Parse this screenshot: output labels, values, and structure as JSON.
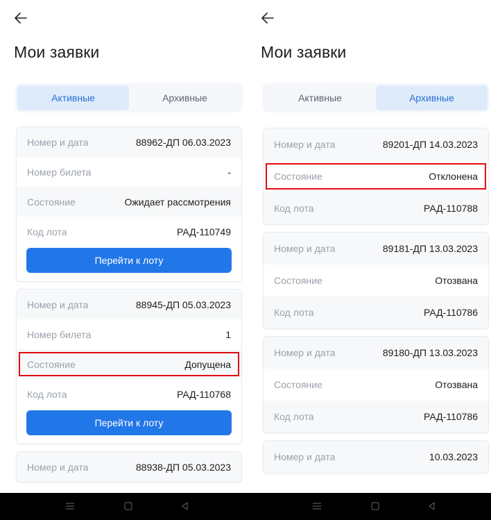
{
  "left": {
    "title": "Мои заявки",
    "tabs": [
      {
        "label": "Активные",
        "active": true
      },
      {
        "label": "Архивные",
        "active": false
      }
    ],
    "cards": [
      {
        "rows": [
          {
            "label": "Номер и дата",
            "value": "88962-ДП 06.03.2023"
          },
          {
            "label": "Номер билета",
            "value": "-"
          },
          {
            "label": "Состояние",
            "value": "Ожидает рассмотрения"
          },
          {
            "label": "Код лота",
            "value": "РАД-110749"
          }
        ],
        "button": "Перейти к лоту"
      },
      {
        "rows": [
          {
            "label": "Номер и дата",
            "value": "88945-ДП 05.03.2023"
          },
          {
            "label": "Номер билета",
            "value": "1"
          },
          {
            "label": "Состояние",
            "value": "Допущена"
          },
          {
            "label": "Код лота",
            "value": "РАД-110768"
          }
        ],
        "button": "Перейти к лоту"
      },
      {
        "rows": [
          {
            "label": "Номер и дата",
            "value": "88938-ДП 05.03.2023"
          }
        ]
      }
    ]
  },
  "right": {
    "title": "Мои заявки",
    "tabs": [
      {
        "label": "Активные",
        "active": false
      },
      {
        "label": "Архивные",
        "active": true
      }
    ],
    "cards": [
      {
        "rows": [
          {
            "label": "Номер и дата",
            "value": "89201-ДП 14.03.2023"
          },
          {
            "label": "Состояние",
            "value": "Отклонена"
          },
          {
            "label": "Код лота",
            "value": "РАД-110788"
          }
        ]
      },
      {
        "rows": [
          {
            "label": "Номер и дата",
            "value": "89181-ДП 13.03.2023"
          },
          {
            "label": "Состояние",
            "value": "Отозвана"
          },
          {
            "label": "Код лота",
            "value": "РАД-110786"
          }
        ]
      },
      {
        "rows": [
          {
            "label": "Номер и дата",
            "value": "89180-ДП 13.03.2023"
          },
          {
            "label": "Состояние",
            "value": "Отозвана"
          },
          {
            "label": "Код лота",
            "value": "РАД-110786"
          }
        ]
      },
      {
        "rows": [
          {
            "label": "Номер и дата",
            "value": "10.03.2023"
          }
        ]
      }
    ]
  },
  "icons": {
    "back": "arrow-left-icon",
    "nav": [
      "menu-icon",
      "home-square-icon",
      "back-triangle-icon"
    ]
  },
  "colors": {
    "accent": "#2277e8",
    "tab_active_bg": "#deebfb",
    "highlight": "#e00b13"
  }
}
